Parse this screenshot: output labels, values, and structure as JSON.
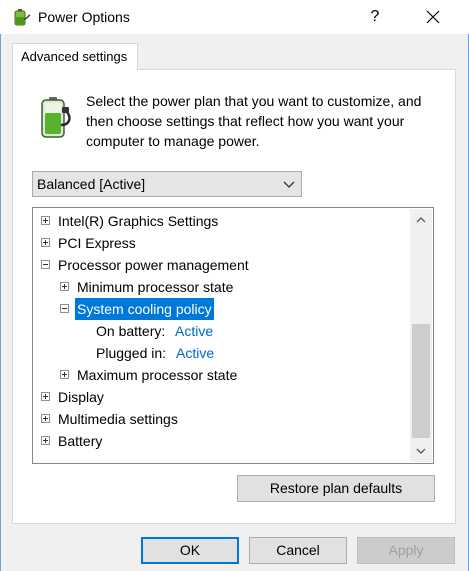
{
  "window": {
    "title": "Power Options",
    "help_glyph": "?",
    "close_glyph": "✕"
  },
  "tab": {
    "label": "Advanced settings"
  },
  "description": "Select the power plan that you want to customize, and then choose settings that reflect how you want your computer to manage power.",
  "plan": {
    "selected": "Balanced [Active]"
  },
  "tree": {
    "items": [
      {
        "label": "Intel(R) Graphics Settings",
        "expander": "plus"
      },
      {
        "label": "PCI Express",
        "expander": "plus"
      },
      {
        "label": "Processor power management",
        "expander": "minus"
      },
      {
        "label": "Minimum processor state",
        "expander": "plus"
      },
      {
        "label": "System cooling policy",
        "expander": "minus",
        "selected": true
      },
      {
        "label": "On battery:",
        "value": "Active"
      },
      {
        "label": "Plugged in:",
        "value": "Active"
      },
      {
        "label": "Maximum processor state",
        "expander": "plus"
      },
      {
        "label": "Display",
        "expander": "plus"
      },
      {
        "label": "Multimedia settings",
        "expander": "plus"
      },
      {
        "label": "Battery",
        "expander": "plus"
      }
    ]
  },
  "buttons": {
    "restore": "Restore plan defaults",
    "ok": "OK",
    "cancel": "Cancel",
    "apply": "Apply"
  },
  "colors": {
    "selection": "#0078d7",
    "link": "#0066cc",
    "accent_border": "#0078d7"
  },
  "icons": {
    "app": "power-options-icon",
    "battery": "battery-plug-icon"
  }
}
